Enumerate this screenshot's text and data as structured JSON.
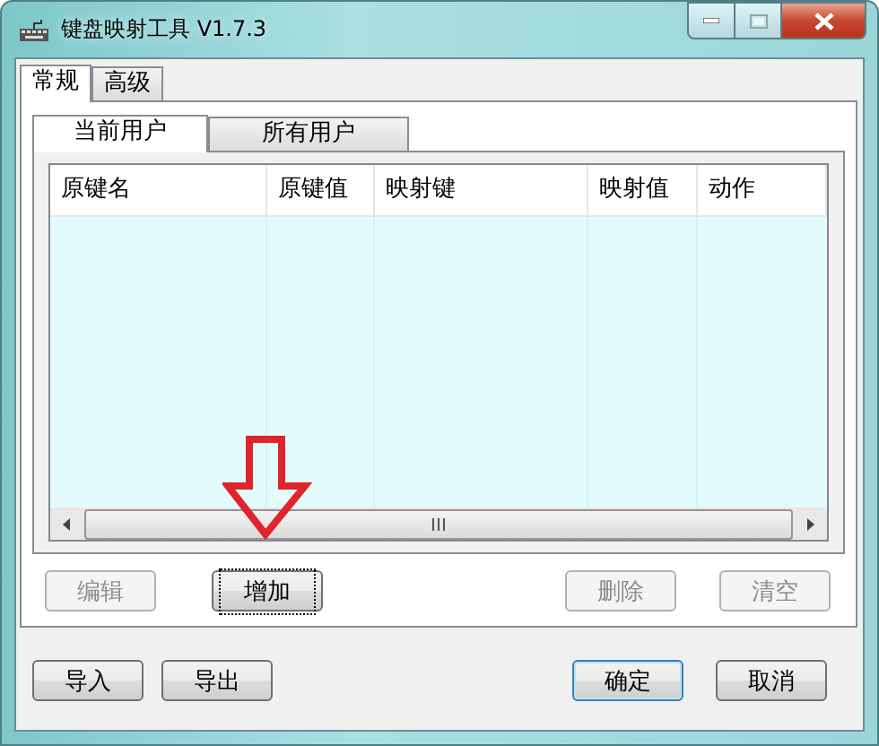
{
  "window": {
    "title": "键盘映射工具 V1.7.3"
  },
  "tabs": [
    {
      "label": "常规",
      "selected": true
    },
    {
      "label": "高级",
      "selected": false
    }
  ],
  "subtabs": [
    {
      "label": "当前用户",
      "selected": true
    },
    {
      "label": "所有用户",
      "selected": false
    }
  ],
  "table": {
    "columns": [
      "原键名",
      "原键值",
      "映射键",
      "映射值",
      "动作"
    ]
  },
  "list_buttons": [
    {
      "label": "编辑",
      "disabled": true,
      "focused": false
    },
    {
      "label": "增加",
      "disabled": false,
      "focused": true
    },
    {
      "label": "删除",
      "disabled": true,
      "focused": false
    },
    {
      "label": "清空",
      "disabled": true,
      "focused": false
    }
  ],
  "dialog_buttons": [
    {
      "label": "导入",
      "default": false
    },
    {
      "label": "导出",
      "default": false
    },
    {
      "label": "确定",
      "default": true
    },
    {
      "label": "取消",
      "default": false
    }
  ]
}
